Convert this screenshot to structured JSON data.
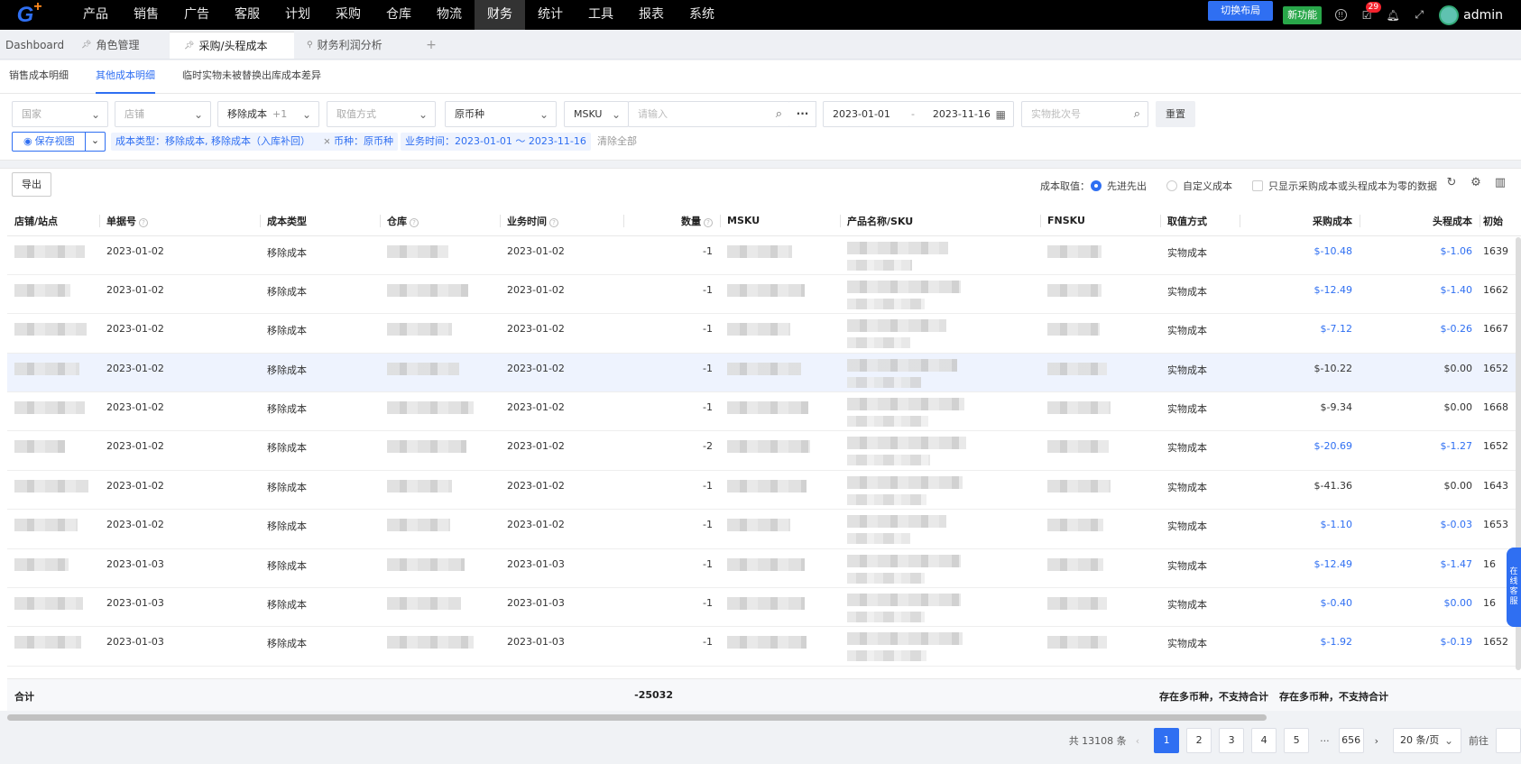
{
  "nav": {
    "menu": [
      "产品",
      "销售",
      "广告",
      "客服",
      "计划",
      "采购",
      "仓库",
      "物流",
      "财务",
      "统计",
      "工具",
      "报表",
      "系统"
    ],
    "active_index": 8,
    "switch_layout": "切换布局",
    "new_feature": "新功能",
    "badge_count": "29",
    "user": "admin"
  },
  "page_tabs": [
    {
      "label": "Dashboard"
    },
    {
      "label": "角色管理"
    },
    {
      "label": "采购/头程成本"
    },
    {
      "label": "财务利润分析"
    }
  ],
  "sub_tabs": [
    "销售成本明细",
    "其他成本明细",
    "临时实物未被替换出库成本差异"
  ],
  "filters": {
    "country": "国家",
    "store": "店铺",
    "type": "移除成本",
    "type_more": "+1",
    "valuation": "取值方式",
    "currency": "原币种",
    "msku_field": "MSKU",
    "msku_placeholder": "请输入",
    "date_from": "2023-01-01",
    "date_sep": "-",
    "date_to": "2023-11-16",
    "batch_placeholder": "实物批次号",
    "reset": "重置",
    "save_view": "保存视图",
    "chips": [
      "成本类型：移除成本, 移除成本（入库补回）",
      "币种：原币种",
      "业务时间：2023-01-01 ～ 2023-11-16"
    ],
    "clear_all": "清除全部"
  },
  "toolbar": {
    "export": "导出",
    "cost_label": "成本取值：",
    "radio_fifo": "先进先出",
    "radio_custom": "自定义成本",
    "checkbox_label": "只显示采购成本或头程成本为零的数据"
  },
  "columns": [
    "店铺/站点",
    "单据号",
    "成本类型",
    "仓库",
    "业务时间",
    "数量",
    "MSKU",
    "产品名称/SKU",
    "FNSKU",
    "取值方式",
    "采购成本",
    "头程成本",
    "初始"
  ],
  "rows": [
    {
      "doc": "2023-01-02",
      "type": "移除成本",
      "time": "2023-01-02",
      "qty": "-1",
      "method": "实物成本",
      "purchase": "$-10.48",
      "first": "$-1.06",
      "init": "1639",
      "pl": true,
      "fl": true
    },
    {
      "doc": "2023-01-02",
      "type": "移除成本",
      "time": "2023-01-02",
      "qty": "-1",
      "method": "实物成本",
      "purchase": "$-12.49",
      "first": "$-1.40",
      "init": "1662",
      "pl": true,
      "fl": true
    },
    {
      "doc": "2023-01-02",
      "type": "移除成本",
      "time": "2023-01-02",
      "qty": "-1",
      "method": "实物成本",
      "purchase": "$-7.12",
      "first": "$-0.26",
      "init": "1667",
      "pl": true,
      "fl": true
    },
    {
      "doc": "2023-01-02",
      "type": "移除成本",
      "time": "2023-01-02",
      "qty": "-1",
      "method": "实物成本",
      "purchase": "$-10.22",
      "first": "$0.00",
      "init": "1652",
      "pl": false,
      "fl": false
    },
    {
      "doc": "2023-01-02",
      "type": "移除成本",
      "time": "2023-01-02",
      "qty": "-1",
      "method": "实物成本",
      "purchase": "$-9.34",
      "first": "$0.00",
      "init": "1668",
      "pl": false,
      "fl": false
    },
    {
      "doc": "2023-01-02",
      "type": "移除成本",
      "time": "2023-01-02",
      "qty": "-2",
      "method": "实物成本",
      "purchase": "$-20.69",
      "first": "$-1.27",
      "init": "1652",
      "pl": true,
      "fl": true
    },
    {
      "doc": "2023-01-02",
      "type": "移除成本",
      "time": "2023-01-02",
      "qty": "-1",
      "method": "实物成本",
      "purchase": "$-41.36",
      "first": "$0.00",
      "init": "1643",
      "pl": false,
      "fl": false
    },
    {
      "doc": "2023-01-02",
      "type": "移除成本",
      "time": "2023-01-02",
      "qty": "-1",
      "method": "实物成本",
      "purchase": "$-1.10",
      "first": "$-0.03",
      "init": "1653",
      "pl": true,
      "fl": true
    },
    {
      "doc": "2023-01-03",
      "type": "移除成本",
      "time": "2023-01-03",
      "qty": "-1",
      "method": "实物成本",
      "purchase": "$-12.49",
      "first": "$-1.47",
      "init": "16",
      "pl": true,
      "fl": true
    },
    {
      "doc": "2023-01-03",
      "type": "移除成本",
      "time": "2023-01-03",
      "qty": "-1",
      "method": "实物成本",
      "purchase": "$-0.40",
      "first": "$0.00",
      "init": "16",
      "pl": true,
      "fl": true
    },
    {
      "doc": "2023-01-03",
      "type": "移除成本",
      "time": "2023-01-03",
      "qty": "-1",
      "method": "实物成本",
      "purchase": "$-1.92",
      "first": "$-0.19",
      "init": "1652",
      "pl": true,
      "fl": true
    }
  ],
  "totals": {
    "label": "合计",
    "qty": "-25032",
    "purchase": "存在多币种，不支持合计",
    "first": "存在多币种，不支持合计"
  },
  "pager": {
    "total": "共 13108 条",
    "pages": [
      "1",
      "2",
      "3",
      "4",
      "5"
    ],
    "ellipsis": "···",
    "last": "656",
    "size": "20 条/页",
    "goto": "前往"
  },
  "side_float": "在线客服"
}
